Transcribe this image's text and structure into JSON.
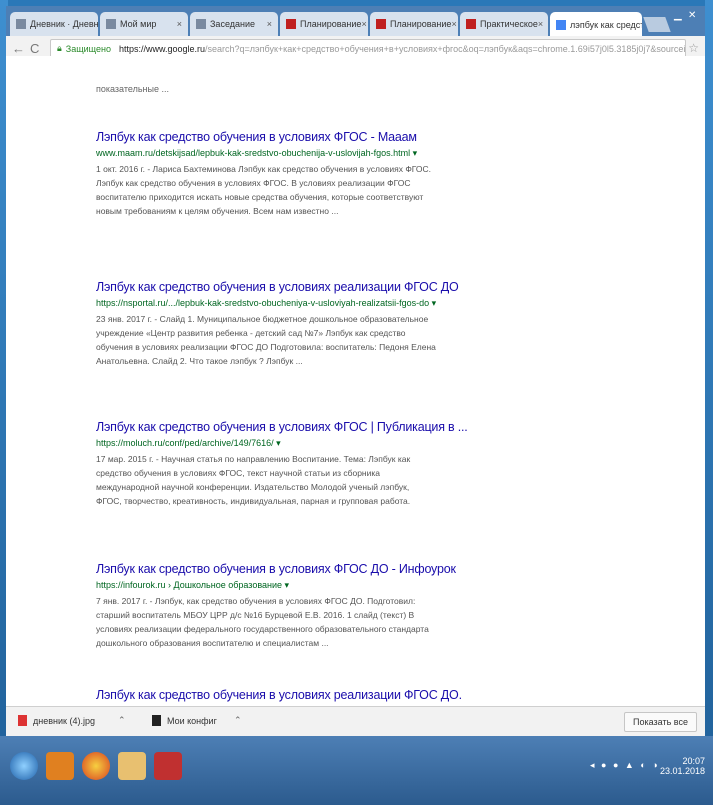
{
  "tabs": [
    {
      "label": "Дневник · Дневник",
      "fav": "page-icon"
    },
    {
      "label": "Мой мир",
      "fav": "page-icon"
    },
    {
      "label": "Заседание",
      "fav": "page-icon"
    },
    {
      "label": "Планирование",
      "fav": "red-icon"
    },
    {
      "label": "Планирование",
      "fav": "red-icon"
    },
    {
      "label": "Практическое",
      "fav": "red-icon"
    },
    {
      "label": "лэпбук как средст",
      "fav": "google-icon"
    }
  ],
  "address": {
    "secure_label": "Защищено",
    "host": "https://www.google.ru",
    "path": "/search?q=лэпбук+как+средство+обучения+в+условиях+фгос&oq=лэпбук&aqs=chrome.1.69i57j0l5.3185j0j7&sourceid=chrome..."
  },
  "top_snippet": "показательные ...",
  "results": [
    {
      "title": "Лэпбук как средство обучения в условиях ФГОС - Мааам",
      "url": "www.maam.ru/detskijsad/lepbuk-kak-sredstvo-obuchenija-v-uslovijah-fgos.html ▾",
      "snippet": "1 окт. 2016 г. - Лариса Бахтеминова Лэпбук как средство обучения в условиях ФГОС. Лэпбук как средство обучения в условиях ФГОС. В условиях реализации ФГОС воспитателю приходится искать новые средства обучения, которые соответствуют новым требованиям к целям обучения. Всем нам известно ..."
    },
    {
      "title": "Лэпбук как средство обучения в условиях реализации ФГОС ДО",
      "url": "https://nsportal.ru/.../lepbuk-kak-sredstvo-obucheniya-v-usloviyah-realizatsii-fgos-do ▾",
      "snippet": "23 янв. 2017 г. - Слайд 1. Муниципальное бюджетное дошкольное образовательное учреждение «Центр развития ребенка - детский сад №7» Лэпбук как средство обучения в условиях реализации ФГОС ДО Подготовила: воспитатель: Педоня Елена Анатольевна. Слайд 2. Что такое лэпбук ? Лэпбук ..."
    },
    {
      "title": "Лэпбук как средство обучения в условиях ФГОС | Публикация в ...",
      "url": "https://moluch.ru/conf/ped/archive/149/7616/ ▾",
      "snippet": "17 мар. 2015 г. - Научная статья по направлению Воспитание. Тема: Лэпбук как средство обучения в условиях ФГОС, текст научной статьи из сборника международной научной конференции. Издательство Молодой ученый лэпбук, ФГОС, творчество, креативность, индивидуальная, парная и групповая работа."
    },
    {
      "title": "Лэпбук как средство обучения в условиях ФГОС ДО - Инфоурок",
      "url": "https://infourok.ru › Дошкольное образование ▾",
      "snippet": "7 янв. 2017 г. - Лэпбук, как средство обучения в условиях ФГОС ДО. Подготовил: старший воспитатель МБОУ ЦРР д/с №16 Бурцевой Е.В. 2016. 1 слайд (текст) В условиях реализации федерального государственного образовательного стандарта дошкольного образования воспитателю и специалистам ..."
    },
    {
      "title": "Лэпбук как средство обучения в условиях реализации ФГОС ДО.",
      "url": "",
      "snippet": ""
    }
  ],
  "downloads": [
    {
      "name": "дневник (4).jpg"
    },
    {
      "name": "Мои конфиг"
    }
  ],
  "downloads_show_all": "Показать все",
  "tray": {
    "time": "20:07",
    "date": "23.01.2018"
  },
  "colors": {
    "link": "#1a0dab",
    "url": "#006621",
    "frame": "#2a78b8"
  }
}
